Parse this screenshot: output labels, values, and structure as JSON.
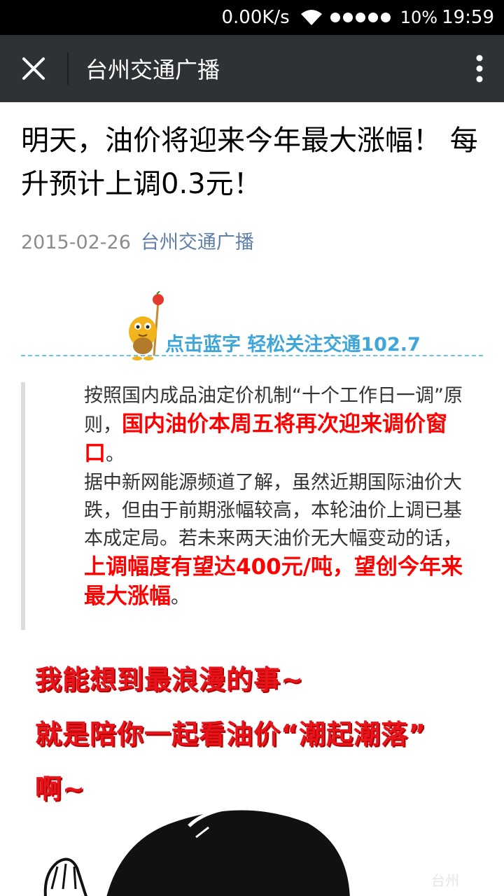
{
  "status": {
    "net_speed": "0.00K/s",
    "battery": "10%",
    "time": "19:59"
  },
  "appbar": {
    "title": "台州交通广播"
  },
  "article": {
    "title": "明天，油价将迎来今年最大涨幅！ 每升预计上调0.3元！",
    "date": "2015-02-26",
    "author": "台州交通广播"
  },
  "banner": {
    "text": "点击蓝字 轻松关注交通102.7"
  },
  "quote": {
    "p1_normal": "按照国内成品油定价机制“十个工作日一调”原则，",
    "p1_red": "国内油价本周五将再次迎来调价窗口",
    "p1_end": "。",
    "p2_normal": "据中新网能源频道了解，虽然近期国际油价大跌，但由于前期涨幅较高，本轮油价上调已基本成定局。若未来两天油价无大幅变动的话，",
    "p2_red": "上调幅度有望达400元/吨，望创今年来最大涨幅",
    "p2_end": "。"
  },
  "comic": {
    "line1": "我能想到最浪漫的事~",
    "line2": "就是陪你一起看油价“潮起潮落”",
    "line3": "啊~",
    "watermark": "台州"
  },
  "colors": {
    "accent_red": "#ff0000",
    "link_blue": "#607fa6",
    "appbar_bg": "#2f3234"
  }
}
